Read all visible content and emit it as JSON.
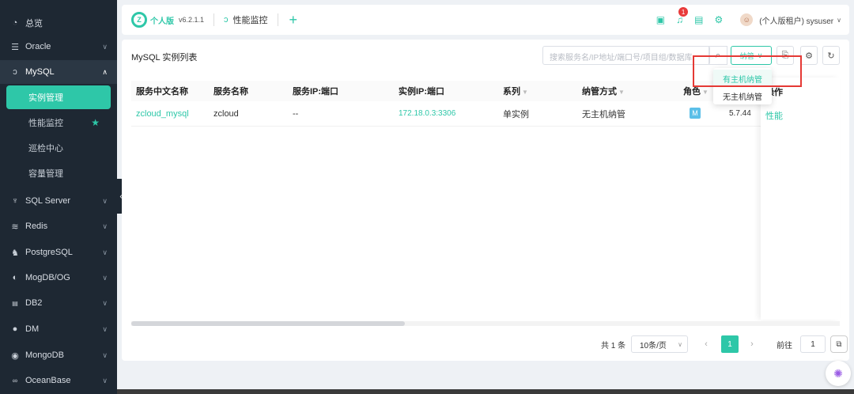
{
  "sidebar": {
    "items": [
      {
        "label": "总览",
        "icon": "gauge-icon",
        "chevron": false
      },
      {
        "label": "Oracle",
        "icon": "database-icon",
        "chevron": true
      },
      {
        "label": "MySQL",
        "icon": "mysql-icon",
        "chevron": true,
        "expanded": true
      },
      {
        "label": "SQL Server",
        "icon": "sqlserver-icon",
        "chevron": true
      },
      {
        "label": "Redis",
        "icon": "redis-icon",
        "chevron": true
      },
      {
        "label": "PostgreSQL",
        "icon": "postgresql-icon",
        "chevron": true
      },
      {
        "label": "MogDB/OG",
        "icon": "mogdb-icon",
        "chevron": true
      },
      {
        "label": "DB2",
        "icon": "db2-icon",
        "chevron": true
      },
      {
        "label": "DM",
        "icon": "dm-icon",
        "chevron": true
      },
      {
        "label": "MongoDB",
        "icon": "mongodb-icon",
        "chevron": true
      },
      {
        "label": "OceanBase",
        "icon": "oceanbase-icon",
        "chevron": true
      }
    ],
    "mysql_sub": [
      {
        "label": "实例管理",
        "active": true
      },
      {
        "label": "性能监控",
        "starred": true
      },
      {
        "label": "巡检中心"
      },
      {
        "label": "容量管理"
      }
    ]
  },
  "header": {
    "logo_text": "个人版",
    "version": "v6.2.1.1",
    "tab_label": "性能监控",
    "notification_count": "1",
    "user": "(个人版租户) sysuser"
  },
  "panel": {
    "title": "MySQL 实例列表",
    "search_placeholder": "搜索服务名/IP地址/端口号/项目组/数据库",
    "select_label": "纳管",
    "columns": [
      "服务中文名称",
      "服务名称",
      "服务IP:端口",
      "实例IP:端口",
      "系列",
      "纳管方式",
      "角色",
      "",
      "操作"
    ],
    "rows": [
      {
        "cn_name": "zcloud_mysql",
        "name": "zcloud",
        "service_ip": "--",
        "instance_ip": "172.18.0.3:3306",
        "series": "单实例",
        "manage_mode": "无主机纳管",
        "role": "M",
        "version": "5.7.44",
        "action": "性能"
      }
    ],
    "dropdown": [
      "有主机纳管",
      "无主机纳管"
    ],
    "pager": {
      "total": "共 1 条",
      "page_size": "10条/页",
      "current_page": "1",
      "goto_label": "前往",
      "goto_value": "1"
    }
  },
  "colors": {
    "accent": "#2ec7a8",
    "sidebar_bg": "#1e2833",
    "highlight_box": "#e53935"
  }
}
